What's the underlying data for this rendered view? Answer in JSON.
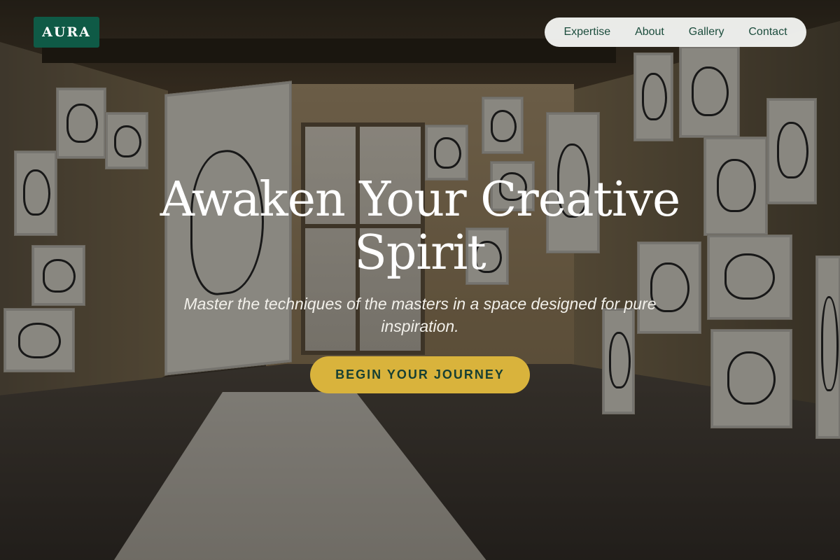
{
  "brand": {
    "logo_text": "AURA"
  },
  "nav": {
    "items": [
      {
        "label": "Expertise"
      },
      {
        "label": "About"
      },
      {
        "label": "Gallery"
      },
      {
        "label": "Contact"
      }
    ]
  },
  "hero": {
    "title_line1": "Awaken Your Creative",
    "title_line2": "Spirit",
    "subtitle": "Master the techniques of the masters in a space designed for pure inspiration.",
    "cta_label": "BEGIN YOUR JOURNEY"
  },
  "colors": {
    "brand_green": "#0f5a46",
    "accent_gold": "#d9b33c",
    "nav_text": "#1c4d3d"
  }
}
